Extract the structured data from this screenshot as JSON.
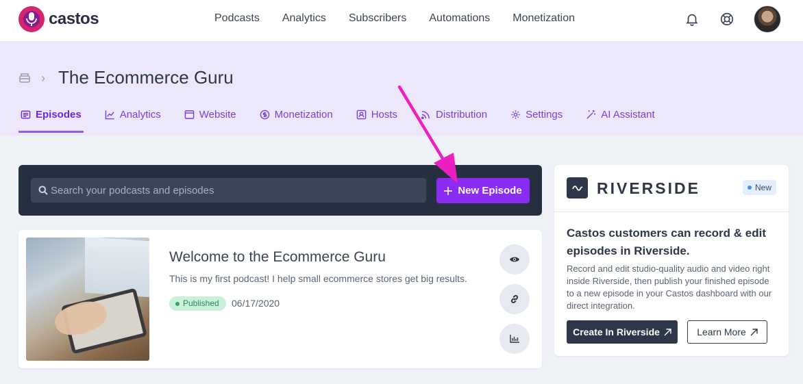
{
  "brand": {
    "name": "castos",
    "accent": "#8b2cf5"
  },
  "nav": {
    "items": [
      "Podcasts",
      "Analytics",
      "Subscribers",
      "Automations",
      "Monetization"
    ]
  },
  "podcast": {
    "title": "The Ecommerce Guru",
    "tabs": [
      "Episodes",
      "Analytics",
      "Website",
      "Monetization",
      "Hosts",
      "Distribution",
      "Settings",
      "AI Assistant"
    ],
    "active_tab": "Episodes"
  },
  "search": {
    "placeholder": "Search your podcasts and episodes",
    "new_episode_label": "New Episode"
  },
  "episode": {
    "title": "Welcome to the Ecommerce Guru",
    "description": "This is my first podcast! I help small ecommerce stores get big results.",
    "status": "Published",
    "date": "06/17/2020",
    "actions": [
      "eye-icon",
      "link-icon",
      "chart-icon"
    ]
  },
  "riverside": {
    "name": "RIVERSIDE",
    "badge": "New",
    "headline": "Castos customers can record & edit episodes in Riverside.",
    "body": "Record and edit studio-quality audio and video right inside Riverside, then publish your finished episode to a new episode in your Castos dashboard with our direct integration.",
    "primary_button": "Create In Riverside",
    "secondary_button": "Learn More"
  },
  "annotation_color": "#ec1fc0"
}
